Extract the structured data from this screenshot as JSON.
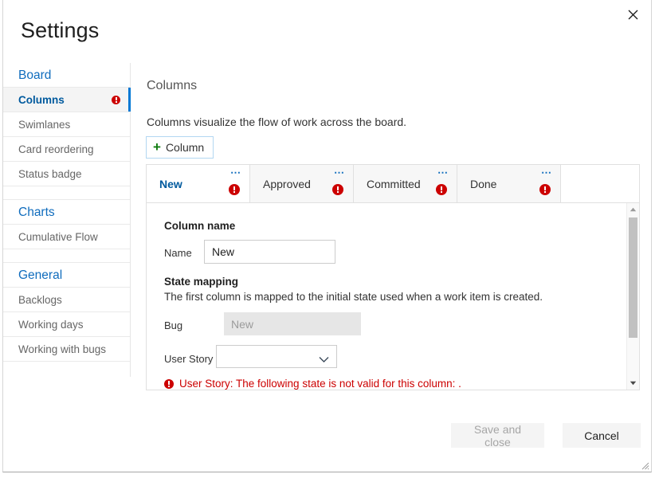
{
  "dialog": {
    "title": "Settings",
    "close_icon": "close-icon"
  },
  "sidebar": {
    "groups": [
      {
        "title": "Board",
        "items": [
          {
            "label": "Columns",
            "selected": true,
            "error": true
          },
          {
            "label": "Swimlanes",
            "selected": false,
            "error": false
          },
          {
            "label": "Card reordering",
            "selected": false,
            "error": false
          },
          {
            "label": "Status badge",
            "selected": false,
            "error": false
          }
        ]
      },
      {
        "title": "Charts",
        "items": [
          {
            "label": "Cumulative Flow",
            "selected": false,
            "error": false
          }
        ]
      },
      {
        "title": "General",
        "items": [
          {
            "label": "Backlogs",
            "selected": false,
            "error": false
          },
          {
            "label": "Working days",
            "selected": false,
            "error": false
          },
          {
            "label": "Working with bugs",
            "selected": false,
            "error": false
          }
        ]
      }
    ]
  },
  "main": {
    "section_title": "Columns",
    "description": "Columns visualize the flow of work across the board.",
    "add_button": {
      "label": "Column",
      "plus_icon": "plus-icon"
    },
    "tabs": [
      {
        "label": "New",
        "active": true,
        "error": true,
        "menu_icon": "ellipsis-icon"
      },
      {
        "label": "Approved",
        "active": false,
        "error": true,
        "menu_icon": "ellipsis-icon"
      },
      {
        "label": "Committed",
        "active": false,
        "error": true,
        "menu_icon": "ellipsis-icon"
      },
      {
        "label": "Done",
        "active": false,
        "error": true,
        "menu_icon": "ellipsis-icon"
      }
    ],
    "form": {
      "column_name_heading": "Column name",
      "name_label": "Name",
      "name_value": "New",
      "state_mapping_heading": "State mapping",
      "state_mapping_desc": "The first column is mapped to the initial state used when a work item is created.",
      "bug_label": "Bug",
      "bug_value": "New",
      "user_story_label": "User Story",
      "user_story_value": "",
      "user_story_chevron_icon": "chevron-down-icon",
      "error_message": "User Story: The following state is not valid for this column: ."
    },
    "scrollbar": {
      "up_icon": "caret-up-icon",
      "down_icon": "caret-down-icon"
    }
  },
  "footer": {
    "save_label": "Save and close",
    "cancel_label": "Cancel",
    "resize_grip_icon": "resize-grip-icon"
  },
  "colors": {
    "accent": "#0078d4",
    "link": "#0f6cbd",
    "error": "#cc0000",
    "plus_green": "#107c10",
    "selected_text": "#005a9e"
  }
}
